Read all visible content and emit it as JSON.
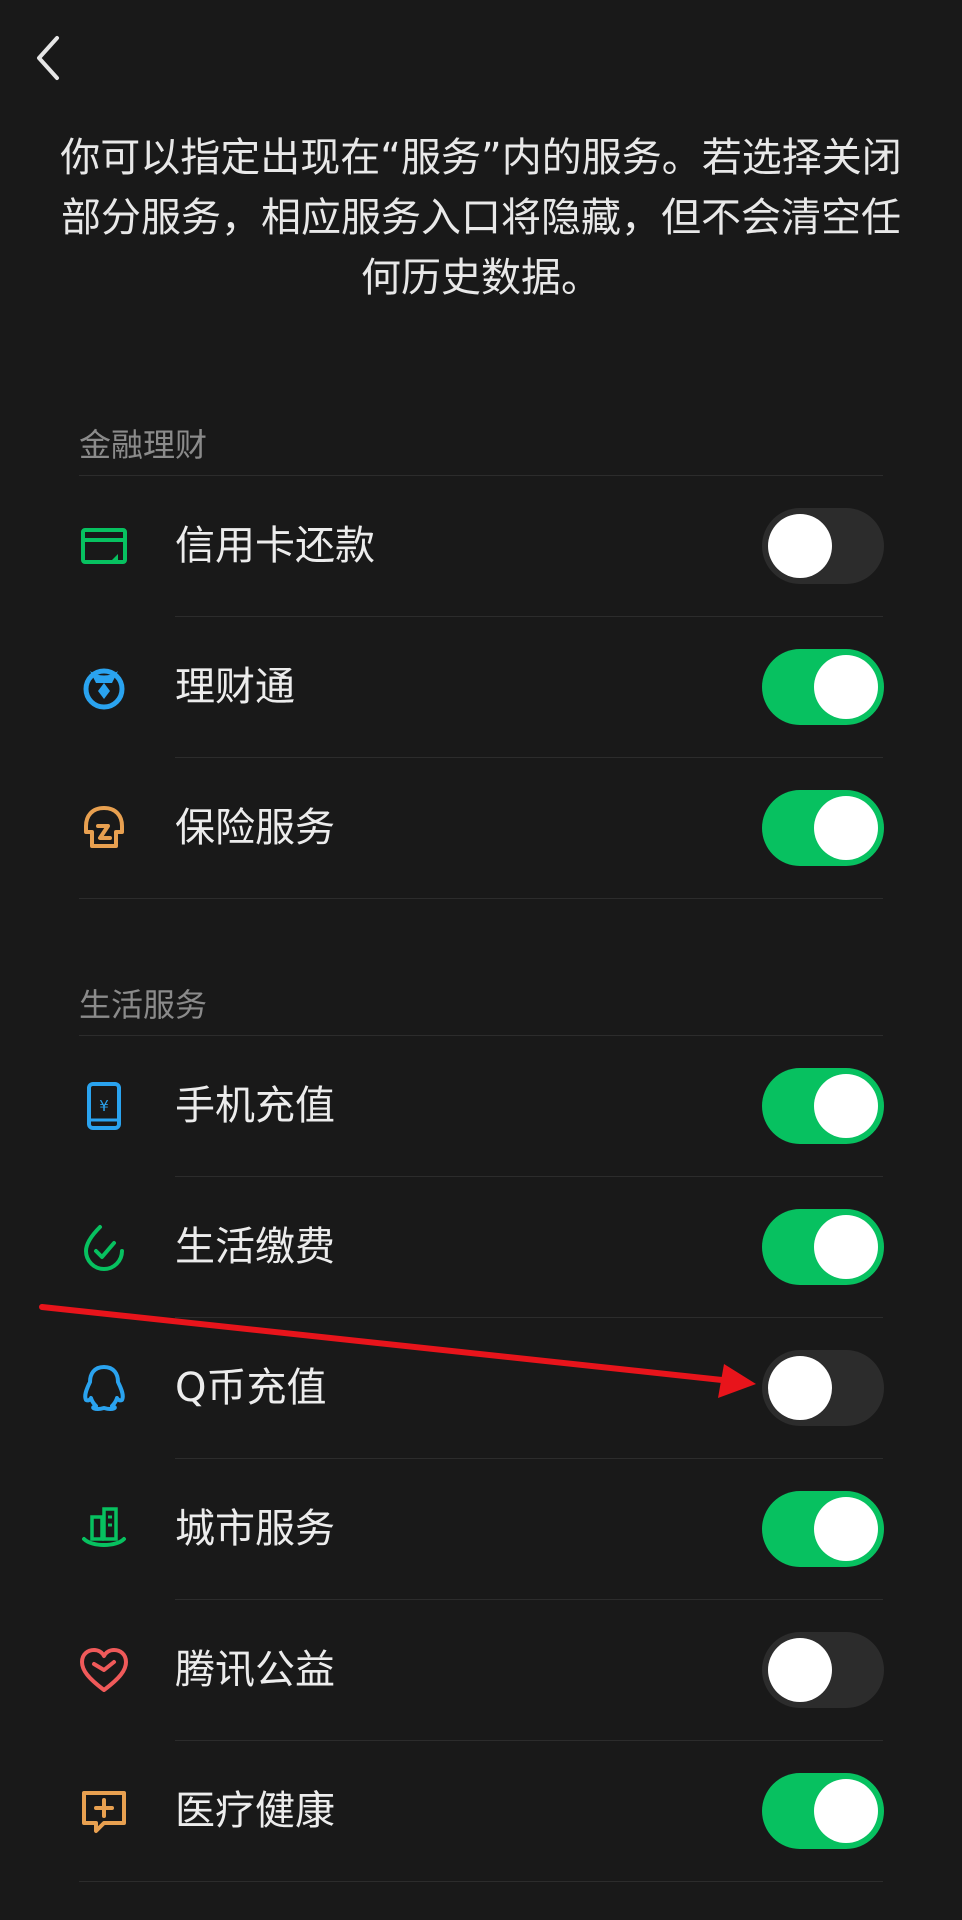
{
  "intro_text": "你可以指定出现在“服务”内的服务。若选择关闭部分服务，相应服务入口将隐藏，但不会清空任何历史数据。",
  "colors": {
    "background": "#191919",
    "toggle_on": "#07c160",
    "toggle_off": "#2c2c2c",
    "annotation_arrow": "#e8141b"
  },
  "sections": [
    {
      "title": "金融理财",
      "items": [
        {
          "label": "信用卡还款",
          "icon": "credit-card-icon",
          "enabled": false
        },
        {
          "label": "理财通",
          "icon": "wealth-icon",
          "enabled": true
        },
        {
          "label": "保险服务",
          "icon": "insurance-icon",
          "enabled": true
        }
      ]
    },
    {
      "title": "生活服务",
      "items": [
        {
          "label": "手机充值",
          "icon": "phone-topup-icon",
          "enabled": true
        },
        {
          "label": "生活缴费",
          "icon": "utility-payment-icon",
          "enabled": true
        },
        {
          "label": "Q币充值",
          "icon": "qq-penguin-icon",
          "enabled": false
        },
        {
          "label": "城市服务",
          "icon": "city-service-icon",
          "enabled": true
        },
        {
          "label": "腾讯公益",
          "icon": "charity-heart-icon",
          "enabled": false
        },
        {
          "label": "医疗健康",
          "icon": "medical-icon",
          "enabled": true
        }
      ]
    }
  ]
}
